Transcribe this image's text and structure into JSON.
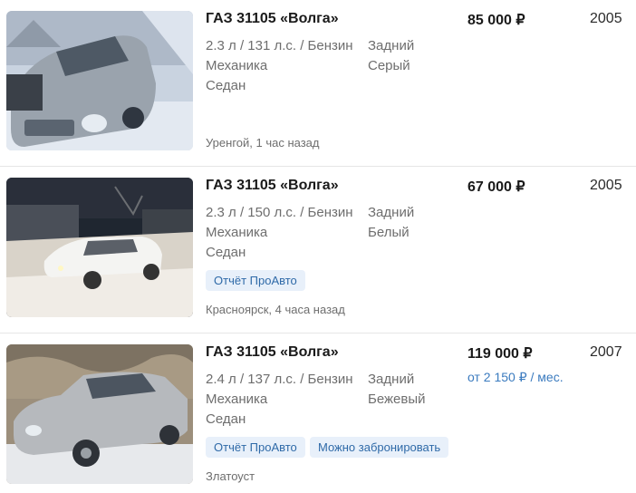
{
  "listings": [
    {
      "title": "ГАЗ 31105 «Волга»",
      "engine": "2.3 л / 131 л.с. / Бензин",
      "transmission": "Механика",
      "body": "Седан",
      "drive": "Задний",
      "color": "Серый",
      "price": "85 000 ₽",
      "year": "2005",
      "location_time": "Уренгой, 1 час назад",
      "badges": []
    },
    {
      "title": "ГАЗ 31105 «Волга»",
      "engine": "2.3 л / 150 л.с. / Бензин",
      "transmission": "Механика",
      "body": "Седан",
      "drive": "Задний",
      "color": "Белый",
      "price": "67 000 ₽",
      "year": "2005",
      "location_time": "Красноярск, 4 часа назад",
      "badges": [
        "Отчёт ПроАвто"
      ]
    },
    {
      "title": "ГАЗ 31105 «Волга»",
      "engine": "2.4 л / 137 л.с. / Бензин",
      "transmission": "Механика",
      "body": "Седан",
      "drive": "Задний",
      "color": "Бежевый",
      "price": "119 000 ₽",
      "credit": "от 2 150 ₽ / мес.",
      "year": "2007",
      "location_time": "Златоуст",
      "badges": [
        "Отчёт ПроАвто",
        "Можно забронировать"
      ]
    }
  ],
  "colors": {
    "accent_link": "#3b7bbf",
    "badge_bg": "#e8f0fa",
    "badge_text": "#2f6aa8",
    "muted_text": "#6e6e6e"
  }
}
